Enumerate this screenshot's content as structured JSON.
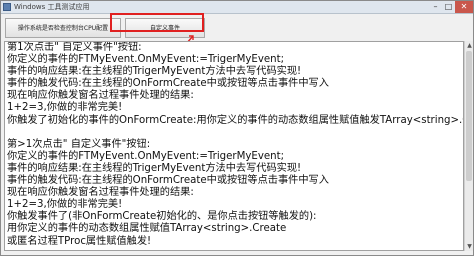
{
  "window": {
    "title": "Windows 工具测试应用",
    "controls": {
      "minimize": "–",
      "maximize": "□",
      "close": "✕"
    },
    "icon": "app-icon"
  },
  "toolbar": {
    "button1_label": "操作系统是否检查控制台CPU配置",
    "button2_label": "自定义事件"
  },
  "annotation": {
    "highlight_color": "#e02020"
  },
  "log": {
    "lines": [
      "第1次点击\" 自定义事件\"按钮:",
      "你定义的事件的FTMyEvent.OnMyEvent:=TrigerMyEvent;",
      "     事件的响应结果:在主线程的TrigerMyEvent方法中去写代码实现!",
      "     事件的触发代码:在主线程的OnFormCreate中或按钮等点击事件中写入",
      "现在响应你触发窗名过程事件处理的结果:",
      "     1+2=3,你做的非常完美!",
      "你触发了初始化的事件的OnFormCreate:用你定义的事件的动态数组属性赋值触发TArray<string>.Create",
      "",
      "第>1次点击\" 自定义事件\"按钮:",
      "你定义的事件的FTMyEvent.OnMyEvent:=TrigerMyEvent;",
      "     事件的响应结果:在主线程的TrigerMyEvent方法中去写代码实现!",
      "     事件的触发代码:在主线程的OnFormCreate中或按钮等点击事件中写入",
      "现在响应你触发窗名过程事件处理的结果:",
      "     1+2=3,你做的非常完美!",
      "你触发事件了(非OnFormCreate初始化的、是你点击按钮等触发的):",
      "     用你定义的事件的动态数组属性赋值TArray<string>.Create",
      "     或匿名过程TProc属性赋值触发!"
    ]
  },
  "scrollbar": {
    "up": "▲",
    "down": "▼"
  }
}
